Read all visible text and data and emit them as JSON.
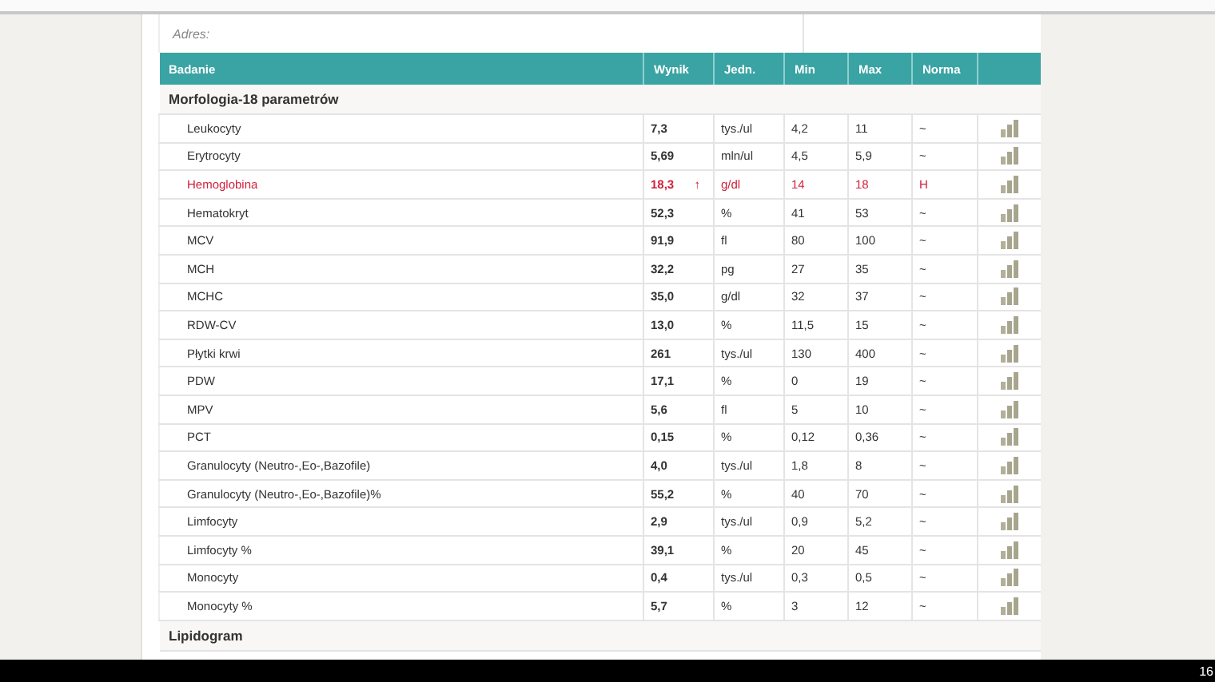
{
  "address_label": "Adres:",
  "table": {
    "columns": [
      "Badanie",
      "Wynik",
      "Jedn.",
      "Min",
      "Max",
      "Norma"
    ],
    "groups": [
      {
        "name": "Morfologia-18 parametrów",
        "rows": [
          {
            "name": "Leukocyty",
            "value": "7,3",
            "unit": "tys./ul",
            "min": "4,2",
            "max": "11",
            "norma": "~",
            "high": false
          },
          {
            "name": "Erytrocyty",
            "value": "5,69",
            "unit": "mln/ul",
            "min": "4,5",
            "max": "5,9",
            "norma": "~",
            "high": false
          },
          {
            "name": "Hemoglobina",
            "value": "18,3",
            "arrow": "↑",
            "unit": "g/dl",
            "min": "14",
            "max": "18",
            "norma": "H",
            "high": true
          },
          {
            "name": "Hematokryt",
            "value": "52,3",
            "unit": "%",
            "min": "41",
            "max": "53",
            "norma": "~",
            "high": false
          },
          {
            "name": "MCV",
            "value": "91,9",
            "unit": "fl",
            "min": "80",
            "max": "100",
            "norma": "~",
            "high": false
          },
          {
            "name": "MCH",
            "value": "32,2",
            "unit": "pg",
            "min": "27",
            "max": "35",
            "norma": "~",
            "high": false
          },
          {
            "name": "MCHC",
            "value": "35,0",
            "unit": "g/dl",
            "min": "32",
            "max": "37",
            "norma": "~",
            "high": false
          },
          {
            "name": "RDW-CV",
            "value": "13,0",
            "unit": "%",
            "min": "11,5",
            "max": "15",
            "norma": "~",
            "high": false
          },
          {
            "name": "Płytki krwi",
            "value": "261",
            "unit": "tys./ul",
            "min": "130",
            "max": "400",
            "norma": "~",
            "high": false
          },
          {
            "name": "PDW",
            "value": "17,1",
            "unit": "%",
            "min": "0",
            "max": "19",
            "norma": "~",
            "high": false
          },
          {
            "name": "MPV",
            "value": "5,6",
            "unit": "fl",
            "min": "5",
            "max": "10",
            "norma": "~",
            "high": false
          },
          {
            "name": "PCT",
            "value": "0,15",
            "unit": "%",
            "min": "0,12",
            "max": "0,36",
            "norma": "~",
            "high": false
          },
          {
            "name": "Granulocyty (Neutro-,Eo-,Bazofile)",
            "value": "4,0",
            "unit": "tys./ul",
            "min": "1,8",
            "max": "8",
            "norma": "~",
            "high": false
          },
          {
            "name": "Granulocyty (Neutro-,Eo-,Bazofile)%",
            "value": "55,2",
            "unit": "%",
            "min": "40",
            "max": "70",
            "norma": "~",
            "high": false
          },
          {
            "name": "Limfocyty",
            "value": "2,9",
            "unit": "tys./ul",
            "min": "0,9",
            "max": "5,2",
            "norma": "~",
            "high": false
          },
          {
            "name": "Limfocyty %",
            "value": "39,1",
            "unit": "%",
            "min": "20",
            "max": "45",
            "norma": "~",
            "high": false
          },
          {
            "name": "Monocyty",
            "value": "0,4",
            "unit": "tys./ul",
            "min": "0,3",
            "max": "0,5",
            "norma": "~",
            "high": false
          },
          {
            "name": "Monocyty %",
            "value": "5,7",
            "unit": "%",
            "min": "3",
            "max": "12",
            "norma": "~",
            "high": false
          }
        ]
      },
      {
        "name": "Lipidogram"
      }
    ]
  },
  "taskbar": {
    "clock": "16"
  }
}
